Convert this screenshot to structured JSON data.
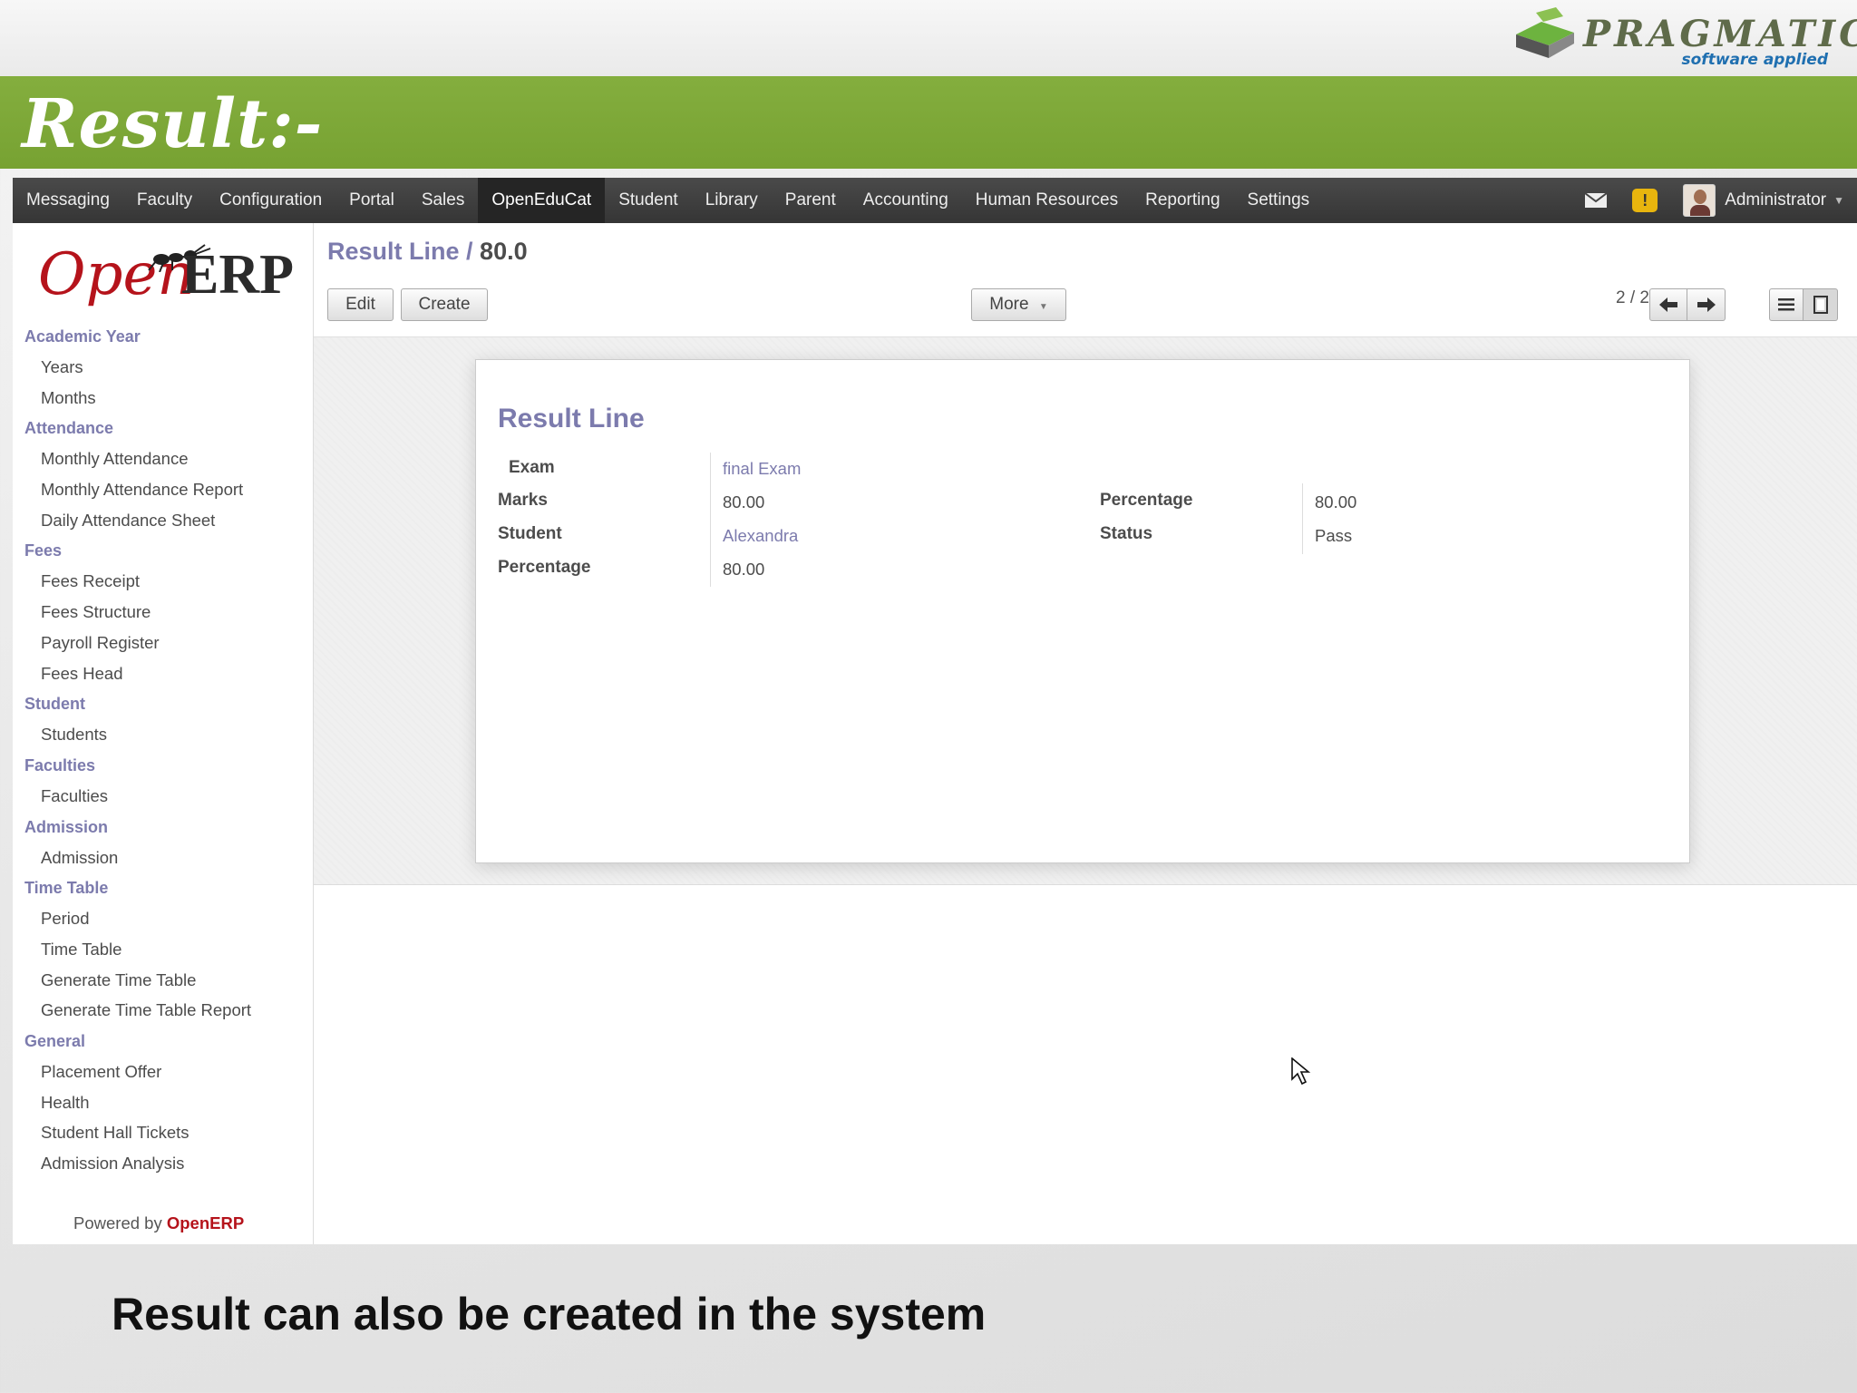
{
  "slide": {
    "brand_name": "PRAGMATIC",
    "brand_tagline": "software applied",
    "heading": "Result:-",
    "caption": "Result  can also be created in the system"
  },
  "topbar": {
    "menu": [
      "Messaging",
      "Faculty",
      "Configuration",
      "Portal",
      "Sales",
      "OpenEduCat",
      "Student",
      "Library",
      "Parent",
      "Accounting",
      "Human Resources",
      "Reporting",
      "Settings"
    ],
    "active_menu": "OpenEduCat",
    "warning_glyph": "!",
    "user_name": "Administrator"
  },
  "sidebar": {
    "logo_open": "Open",
    "logo_erp": "ERP",
    "sections": [
      {
        "title": "Academic Year",
        "items": [
          "Years",
          "Months"
        ]
      },
      {
        "title": "Attendance",
        "items": [
          "Monthly Attendance",
          "Monthly Attendance Report",
          "Daily Attendance Sheet"
        ]
      },
      {
        "title": "Fees",
        "items": [
          "Fees Receipt",
          "Fees Structure",
          "Payroll Register",
          "Fees Head"
        ]
      },
      {
        "title": "Student",
        "items": [
          "Students"
        ]
      },
      {
        "title": "Faculties",
        "items": [
          "Faculties"
        ]
      },
      {
        "title": "Admission",
        "items": [
          "Admission"
        ]
      },
      {
        "title": "Time Table",
        "items": [
          "Period",
          "Time Table",
          "Generate Time Table",
          "Generate Time Table Report"
        ]
      },
      {
        "title": "General",
        "items": [
          "Placement Offer",
          "Health",
          "Student Hall Tickets",
          "Admission Analysis"
        ]
      }
    ],
    "powered_by": "Powered by",
    "powered_brand": "OpenERP"
  },
  "view": {
    "breadcrumb_parent": "Result Line",
    "breadcrumb_sep": " / ",
    "breadcrumb_current": "80.0",
    "edit_label": "Edit",
    "create_label": "Create",
    "more_label": "More",
    "pager": "2 / 2"
  },
  "form": {
    "title": "Result Line",
    "exam_label": "Exam",
    "exam_value": "final Exam",
    "marks_label": "Marks",
    "marks_value": "80.00",
    "student_label": "Student",
    "student_value": "Alexandra",
    "percentage_label": "Percentage",
    "percentage_value": "80.00",
    "right_percentage_label": "Percentage",
    "right_percentage_value": "80.00",
    "status_label": "Status",
    "status_value": "Pass"
  }
}
